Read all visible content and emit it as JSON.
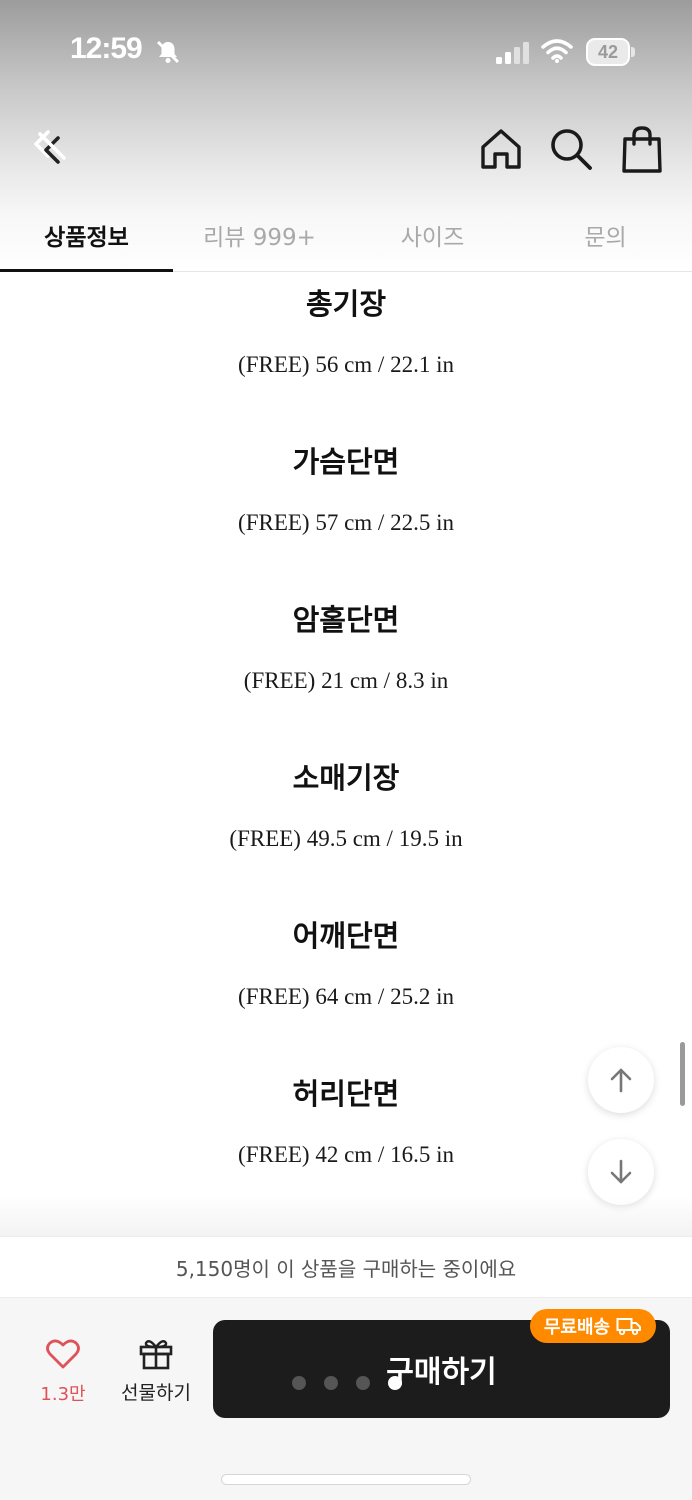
{
  "status_bar": {
    "time": "12:59",
    "battery": "42"
  },
  "icons": {
    "back": "back-chevrons-icon",
    "home": "home-icon",
    "search": "search-icon",
    "cart": "shopping-bag-icon",
    "like": "heart-icon",
    "gift": "gift-icon",
    "delivery": "truck-icon",
    "scroll_up": "arrow-up-icon",
    "scroll_down": "arrow-down-icon"
  },
  "tabs": [
    {
      "label": "상품정보",
      "active": true
    },
    {
      "label": "리뷰 999+",
      "active": false
    },
    {
      "label": "사이즈",
      "active": false
    },
    {
      "label": "문의",
      "active": false
    }
  ],
  "size_specs": [
    {
      "label": "총기장",
      "value": "(FREE) 56 cm / 22.1 in"
    },
    {
      "label": "가슴단면",
      "value": "(FREE) 57 cm / 22.5 in"
    },
    {
      "label": "암홀단면",
      "value": "(FREE) 21 cm / 8.3 in"
    },
    {
      "label": "소매기장",
      "value": "(FREE) 49.5 cm / 19.5 in"
    },
    {
      "label": "어깨단면",
      "value": "(FREE) 64 cm / 25.2 in"
    },
    {
      "label": "허리단면",
      "value": "(FREE) 42 cm / 16.5 in"
    }
  ],
  "social_proof": "5,150명이 이 상품을 구매하는 중이에요",
  "bottom_bar": {
    "like_count": "1.3만",
    "gift_label": "선물하기",
    "buy_label": "구매하기",
    "free_shipping_badge": "무료배송"
  },
  "colors": {
    "accent_orange": "#ff8a00",
    "like_red": "#e0525a",
    "buy_button": "#1c1c1c"
  }
}
